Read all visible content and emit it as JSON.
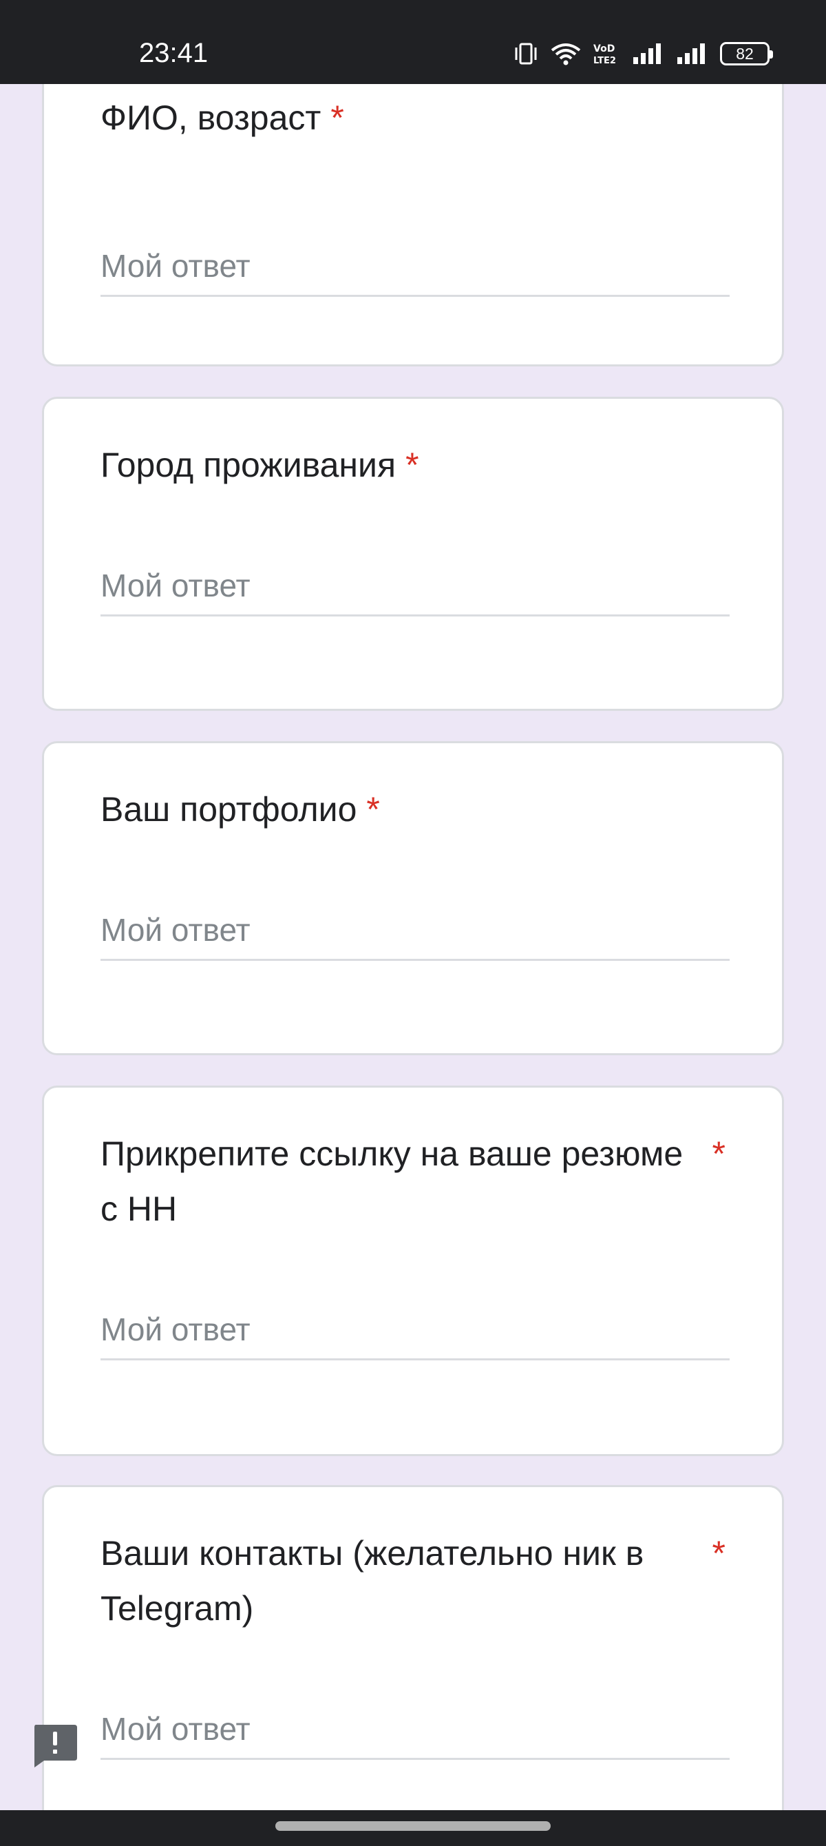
{
  "status_bar": {
    "time": "23:41",
    "battery": "82",
    "icons": [
      "vibrate-icon",
      "wifi-icon",
      "volte-icon",
      "signal-icon",
      "signal-icon"
    ]
  },
  "form": {
    "questions": [
      {
        "title": "ФИО, возраст",
        "required_mark": "*",
        "placeholder": "Мой ответ"
      },
      {
        "title": "Город проживания",
        "required_mark": "*",
        "placeholder": "Мой ответ"
      },
      {
        "title": "Ваш портфолио",
        "required_mark": "*",
        "placeholder": "Мой ответ"
      },
      {
        "title": "Прикрепите ссылку на ваше резюме с HH",
        "required_mark": "*",
        "placeholder": "Мой ответ"
      },
      {
        "title": "Ваши контакты (желательно ник в Telegram)",
        "required_mark": "*",
        "placeholder": "Мой ответ"
      }
    ]
  },
  "status_bar_icons": {
    "volte_label": "VoLTE"
  },
  "feedback_icon": "report-feedback-icon",
  "colors": {
    "background": "#ede7f6",
    "required": "#d93025",
    "status_bar": "#202124",
    "placeholder": "#80868b"
  }
}
